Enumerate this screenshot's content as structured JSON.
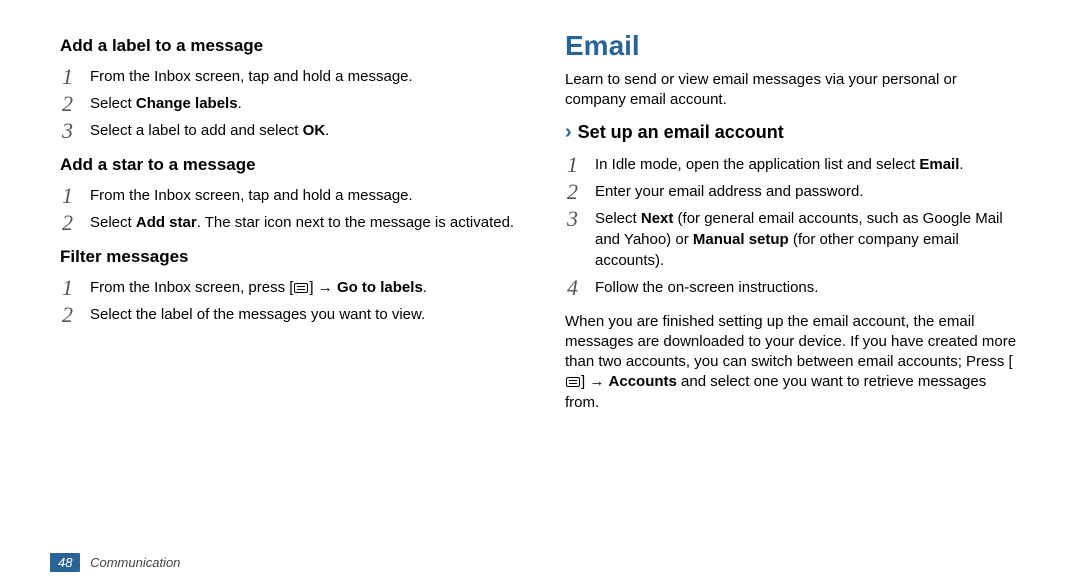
{
  "left": {
    "topic1": {
      "title": "Add a label to a message",
      "step1": "From the Inbox screen, tap and hold a message.",
      "step2_pre": "Select ",
      "step2_bold": "Change labels",
      "step2_post": ".",
      "step3_pre": "Select a label to add and select ",
      "step3_bold": "OK",
      "step3_post": "."
    },
    "topic2": {
      "title": "Add a star to a message",
      "step1": "From the Inbox screen, tap and hold a message.",
      "step2_pre": "Select ",
      "step2_bold": "Add star",
      "step2_post": ". The star icon next to the message is activated."
    },
    "topic3": {
      "title": "Filter messages",
      "step1_pre": "From the Inbox screen, press [",
      "step1_mid": "] → ",
      "step1_bold": "Go to labels",
      "step1_post": ".",
      "step2": "Select the label of the messages you want to view."
    }
  },
  "right": {
    "title": "Email",
    "intro": "Learn to send or view email messages via your personal or company email account.",
    "subsection": "Set up an email account",
    "step1_pre": "In Idle mode, open the application list and select ",
    "step1_bold": "Email",
    "step1_post": ".",
    "step2": "Enter your email address and password.",
    "step3_pre": "Select ",
    "step3_b1": "Next",
    "step3_mid": " (for general email accounts, such as Google Mail and Yahoo) or ",
    "step3_b2": "Manual setup",
    "step3_post": " (for other company email accounts).",
    "step4": "Follow the on-screen instructions.",
    "para_pre": "When you are finished setting up the email account, the email messages are downloaded to your device. If you have created more than two accounts, you can switch between email accounts; Press [",
    "para_mid": "] → ",
    "para_bold": "Accounts",
    "para_post": " and select one you want to retrieve messages from."
  },
  "footer": {
    "page": "48",
    "chapter": "Communication"
  }
}
